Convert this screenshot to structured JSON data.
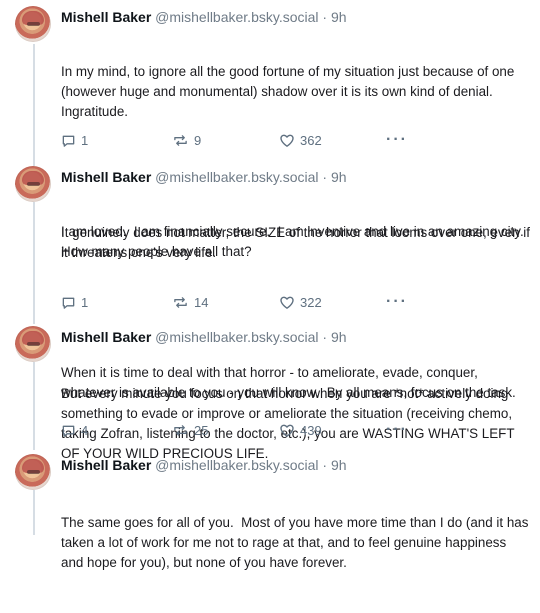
{
  "posts": [
    {
      "author": "Mishell Baker",
      "handle": "@mishellbaker.bsky.social",
      "dot": "·",
      "time": "9h",
      "paragraphs": [
        "In my mind, to ignore all the good fortune of my situation just because of one (however huge and monumental) shadow over it is its own kind of denial.  Ingratitude.",
        "I am loved.  I am financially secure.  I am inventive and live in an amazing city.  How many people have all that?"
      ],
      "reply_count": "1",
      "repost_count": "9",
      "like_count": "362",
      "more_label": "···"
    },
    {
      "author": "Mishell Baker",
      "handle": "@mishellbaker.bsky.social",
      "dot": "·",
      "time": "9h",
      "paragraphs": [
        "It genuinely does not matter, the SIZE of the horror that looms over one, even if it threatens one's very life.",
        "When it is time to deal with that horror - to ameliorate, evade, conquer, whatever is available to you - you will know.  By all means, focus on the task."
      ],
      "reply_count": "1",
      "repost_count": "14",
      "like_count": "322",
      "more_label": "···"
    },
    {
      "author": "Mishell Baker",
      "handle": "@mishellbaker.bsky.social",
      "dot": "·",
      "time": "9h",
      "paragraphs": [
        "But every minute you focus on that horror when you are *not* actively doing something to evade or improve or ameliorate the situation (receiving chemo, taking Zofran, listening to the doctor, etc.), you are WASTING WHAT'S LEFT OF YOUR WILD PRECIOUS LIFE."
      ],
      "reply_count": "4",
      "repost_count": "25",
      "like_count": "439",
      "more_label": "···"
    },
    {
      "author": "Mishell Baker",
      "handle": "@mishellbaker.bsky.social",
      "dot": "·",
      "time": "9h",
      "paragraphs": [
        "The same goes for all of you.  Most of you have more time than I do (and it has taken a lot of work for me not to rage at that, and to feel genuine happiness and hope for you), but none of you have forever."
      ]
    }
  ],
  "icons": {
    "reply": "reply-icon",
    "repost": "repost-icon",
    "like": "heart-icon",
    "more": "more-options-icon"
  },
  "colors": {
    "text": "#1b1b1f",
    "muted": "#6f7b87",
    "thread_line": "#d6dde4"
  }
}
